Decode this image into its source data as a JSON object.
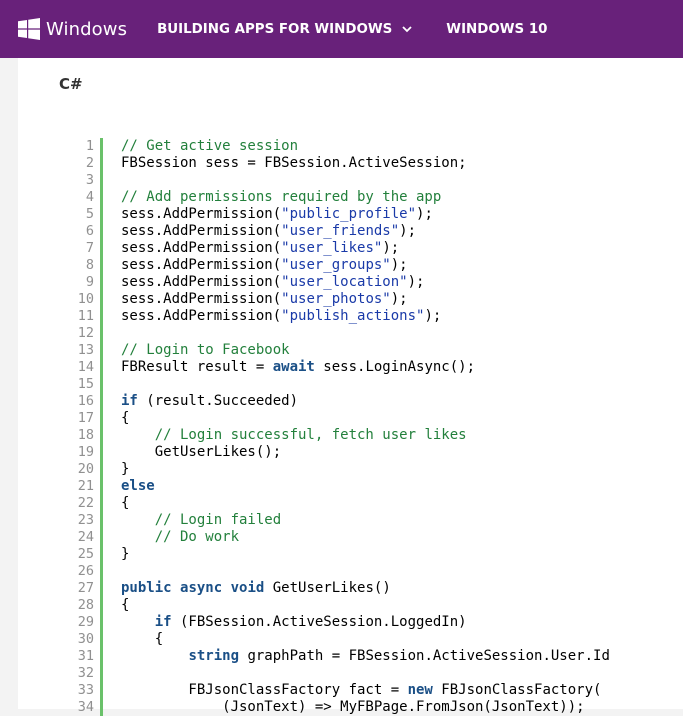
{
  "header": {
    "brand": "Windows",
    "nav": [
      {
        "label": "BUILDING APPS FOR WINDOWS",
        "has_dropdown": true
      },
      {
        "label": "WINDOWS 10",
        "has_dropdown": false
      }
    ],
    "colors": {
      "bar": "#68217a",
      "text": "#ffffff"
    },
    "icons": {
      "logo": "windows-logo-icon",
      "dropdown": "chevron-down-icon"
    }
  },
  "code_section": {
    "language": "C#",
    "colors": {
      "comment": "#23803c",
      "string": "#1a3aa8",
      "keyword": "#1a4f86",
      "line_number": "#909090",
      "gutter": "#6ac16a"
    },
    "lines": [
      [
        [
          "c",
          "// Get active session"
        ]
      ],
      [
        [
          "p",
          "FBSession sess = FBSession.ActiveSession;"
        ]
      ],
      [],
      [
        [
          "c",
          "// Add permissions required by the app"
        ]
      ],
      [
        [
          "p",
          "sess.AddPermission("
        ],
        [
          "s",
          "\"public_profile\""
        ],
        [
          "p",
          ");"
        ]
      ],
      [
        [
          "p",
          "sess.AddPermission("
        ],
        [
          "s",
          "\"user_friends\""
        ],
        [
          "p",
          ");"
        ]
      ],
      [
        [
          "p",
          "sess.AddPermission("
        ],
        [
          "s",
          "\"user_likes\""
        ],
        [
          "p",
          ");"
        ]
      ],
      [
        [
          "p",
          "sess.AddPermission("
        ],
        [
          "s",
          "\"user_groups\""
        ],
        [
          "p",
          ");"
        ]
      ],
      [
        [
          "p",
          "sess.AddPermission("
        ],
        [
          "s",
          "\"user_location\""
        ],
        [
          "p",
          ");"
        ]
      ],
      [
        [
          "p",
          "sess.AddPermission("
        ],
        [
          "s",
          "\"user_photos\""
        ],
        [
          "p",
          ");"
        ]
      ],
      [
        [
          "p",
          "sess.AddPermission("
        ],
        [
          "s",
          "\"publish_actions\""
        ],
        [
          "p",
          ");"
        ]
      ],
      [],
      [
        [
          "c",
          "// Login to Facebook"
        ]
      ],
      [
        [
          "p",
          "FBResult result = "
        ],
        [
          "k",
          "await"
        ],
        [
          "p",
          " sess.LoginAsync();"
        ]
      ],
      [],
      [
        [
          "k",
          "if"
        ],
        [
          "p",
          " (result.Succeeded)"
        ]
      ],
      [
        [
          "p",
          "{"
        ]
      ],
      [
        [
          "p",
          "    "
        ],
        [
          "c",
          "// Login successful, fetch user likes"
        ]
      ],
      [
        [
          "p",
          "    GetUserLikes();"
        ]
      ],
      [
        [
          "p",
          "}"
        ]
      ],
      [
        [
          "k",
          "else"
        ]
      ],
      [
        [
          "p",
          "{"
        ]
      ],
      [
        [
          "p",
          "    "
        ],
        [
          "c",
          "// Login failed"
        ]
      ],
      [
        [
          "p",
          "    "
        ],
        [
          "c",
          "// Do work"
        ]
      ],
      [
        [
          "p",
          "}"
        ]
      ],
      [],
      [
        [
          "k",
          "public"
        ],
        [
          "p",
          " "
        ],
        [
          "k",
          "async"
        ],
        [
          "p",
          " "
        ],
        [
          "k",
          "void"
        ],
        [
          "p",
          " GetUserLikes()"
        ]
      ],
      [
        [
          "p",
          "{"
        ]
      ],
      [
        [
          "p",
          "    "
        ],
        [
          "k",
          "if"
        ],
        [
          "p",
          " (FBSession.ActiveSession.LoggedIn)"
        ]
      ],
      [
        [
          "p",
          "    {"
        ]
      ],
      [
        [
          "p",
          "        "
        ],
        [
          "k",
          "string"
        ],
        [
          "p",
          " graphPath = FBSession.ActiveSession.User.Id"
        ]
      ],
      [],
      [
        [
          "p",
          "        FBJsonClassFactory fact = "
        ],
        [
          "k",
          "new"
        ],
        [
          "p",
          " FBJsonClassFactory("
        ]
      ],
      [
        [
          "p",
          "            (JsonText) => MyFBPage.FromJson(JsonText));"
        ]
      ]
    ]
  }
}
